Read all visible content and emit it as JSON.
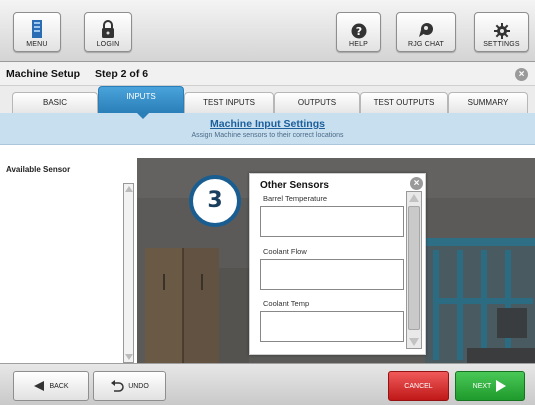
{
  "toolbar": {
    "menu_label": "MENU",
    "login_label": "LOGIN",
    "help_label": "HELP",
    "chat_label": "RJG CHAT",
    "settings_label": "SETTINGS"
  },
  "header": {
    "title": "Machine Setup",
    "step": "Step 2 of 6"
  },
  "tabs": [
    {
      "label": "BASIC",
      "active": false
    },
    {
      "label": "INPUTS",
      "active": true
    },
    {
      "label": "TEST INPUTS",
      "active": false
    },
    {
      "label": "OUTPUTS",
      "active": false
    },
    {
      "label": "TEST OUTPUTS",
      "active": false
    },
    {
      "label": "SUMMARY",
      "active": false
    }
  ],
  "banner": {
    "title": "Machine Input Settings",
    "subtitle": "Assign Machine sensors to their correct locations"
  },
  "left_panel": {
    "heading": "Available Sensor"
  },
  "step_badge": "3",
  "modal": {
    "title": "Other Sensors",
    "fields": [
      {
        "label": "Barrel Temperature",
        "value": ""
      },
      {
        "label": "Coolant Flow",
        "value": ""
      },
      {
        "label": "Coolant Temp",
        "value": ""
      }
    ]
  },
  "bottom": {
    "back_label": "BACK",
    "undo_label": "UNDO",
    "cancel_label": "CANCEL",
    "next_label": "NEXT"
  },
  "colors": {
    "accent": "#2a7fb8",
    "banner": "#c8dff0",
    "cancel": "#c01818",
    "next": "#1f9a2c"
  }
}
